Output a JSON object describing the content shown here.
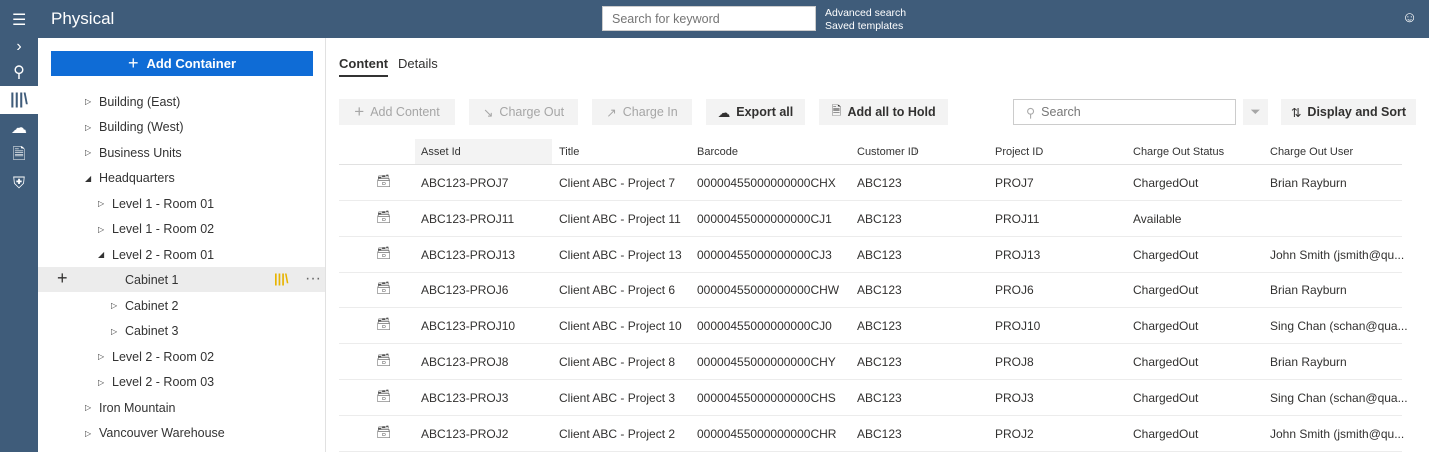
{
  "header": {
    "title": "Physical",
    "search_placeholder": "Search for keyword",
    "advanced_search": "Advanced search",
    "saved_templates": "Saved templates"
  },
  "tree": {
    "add_container": "Add Container",
    "items": [
      {
        "label": "Building (East)",
        "level": 0,
        "state": "collapsed"
      },
      {
        "label": "Building (West)",
        "level": 0,
        "state": "collapsed"
      },
      {
        "label": "Business Units",
        "level": 0,
        "state": "collapsed"
      },
      {
        "label": "Headquarters",
        "level": 0,
        "state": "expanded"
      },
      {
        "label": "Level 1 - Room 01",
        "level": 1,
        "state": "collapsed"
      },
      {
        "label": "Level 1 - Room 02",
        "level": 1,
        "state": "collapsed"
      },
      {
        "label": "Level 2 - Room 01",
        "level": 1,
        "state": "expanded"
      },
      {
        "label": "Cabinet 1",
        "level": 2,
        "state": "selected"
      },
      {
        "label": "Cabinet 2",
        "level": 2,
        "state": "collapsed"
      },
      {
        "label": "Cabinet 3",
        "level": 2,
        "state": "collapsed"
      },
      {
        "label": "Level 2 - Room 02",
        "level": 1,
        "state": "collapsed"
      },
      {
        "label": "Level 2 - Room 03",
        "level": 1,
        "state": "collapsed"
      },
      {
        "label": "Iron Mountain",
        "level": 0,
        "state": "collapsed"
      },
      {
        "label": "Vancouver Warehouse",
        "level": 0,
        "state": "collapsed"
      }
    ]
  },
  "tabs": [
    "Content",
    "Details"
  ],
  "toolbar": {
    "add_content": "Add Content",
    "charge_out": "Charge Out",
    "charge_in": "Charge In",
    "export_all": "Export all",
    "add_hold": "Add all to Hold",
    "search_placeholder": "Search",
    "display_sort": "Display and Sort"
  },
  "table": {
    "columns": [
      "Asset Id",
      "Title",
      "Barcode",
      "Customer ID",
      "Project ID",
      "Charge Out Status",
      "Charge Out User"
    ],
    "rows": [
      [
        "ABC123-PROJ7",
        "Client ABC - Project 7",
        "00000455000000000CHX",
        "ABC123",
        "PROJ7",
        "ChargedOut",
        "Brian Rayburn"
      ],
      [
        "ABC123-PROJ11",
        "Client ABC - Project 11",
        "00000455000000000CJ1",
        "ABC123",
        "PROJ11",
        "Available",
        ""
      ],
      [
        "ABC123-PROJ13",
        "Client ABC - Project 13",
        "00000455000000000CJ3",
        "ABC123",
        "PROJ13",
        "ChargedOut",
        "John Smith (jsmith@qu..."
      ],
      [
        "ABC123-PROJ6",
        "Client ABC - Project 6",
        "00000455000000000CHW",
        "ABC123",
        "PROJ6",
        "ChargedOut",
        "Brian Rayburn"
      ],
      [
        "ABC123-PROJ10",
        "Client ABC - Project 10",
        "00000455000000000CJ0",
        "ABC123",
        "PROJ10",
        "ChargedOut",
        "Sing Chan (schan@qua..."
      ],
      [
        "ABC123-PROJ8",
        "Client ABC - Project 8",
        "00000455000000000CHY",
        "ABC123",
        "PROJ8",
        "ChargedOut",
        "Brian Rayburn"
      ],
      [
        "ABC123-PROJ3",
        "Client ABC - Project 3",
        "00000455000000000CHS",
        "ABC123",
        "PROJ3",
        "ChargedOut",
        "Sing Chan (schan@qua..."
      ],
      [
        "ABC123-PROJ2",
        "Client ABC - Project 2",
        "00000455000000000CHR",
        "ABC123",
        "PROJ2",
        "ChargedOut",
        "John Smith (jsmith@qu..."
      ]
    ]
  }
}
